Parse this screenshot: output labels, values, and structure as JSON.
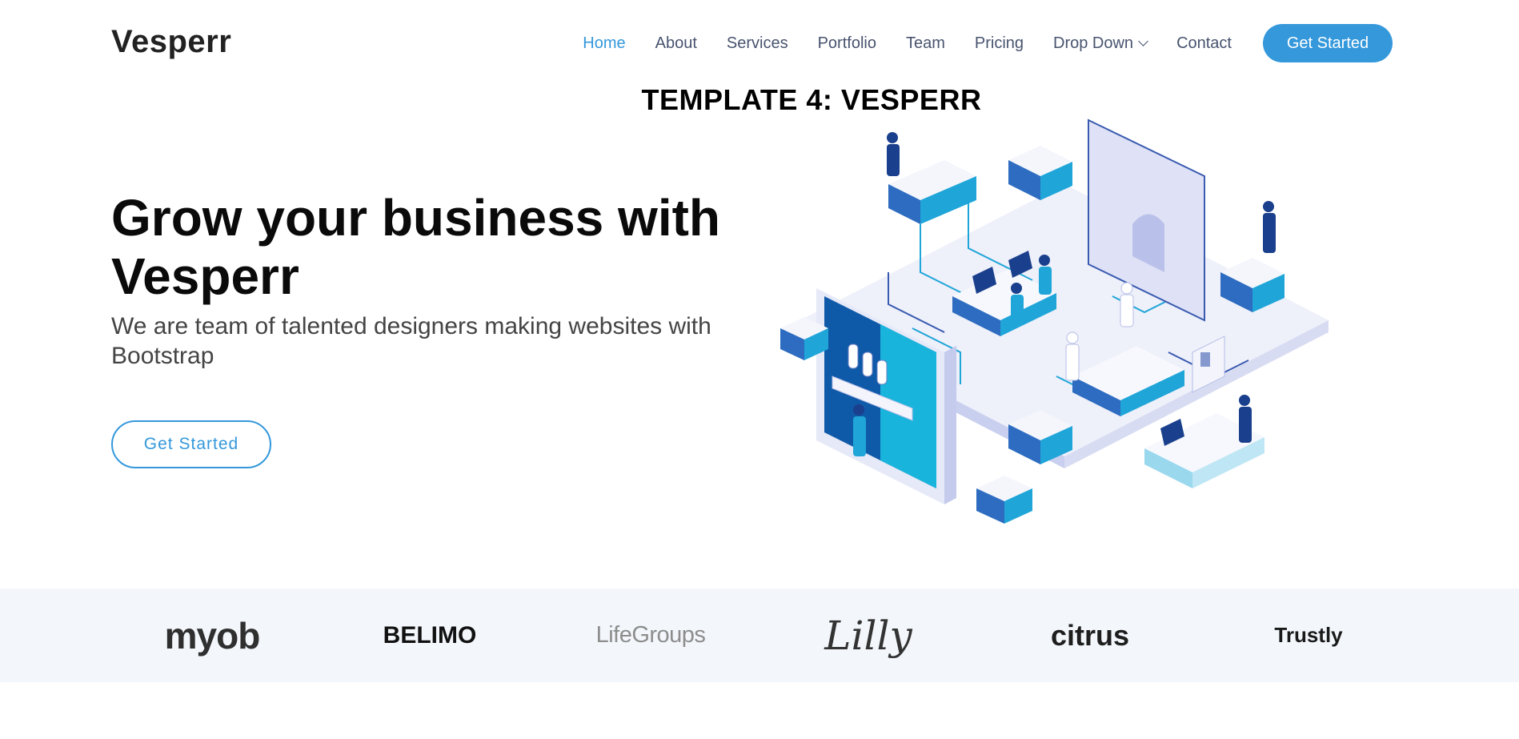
{
  "header": {
    "logo": "Vesperr",
    "nav": [
      {
        "label": "Home",
        "active": true
      },
      {
        "label": "About",
        "active": false
      },
      {
        "label": "Services",
        "active": false
      },
      {
        "label": "Portfolio",
        "active": false
      },
      {
        "label": "Team",
        "active": false
      },
      {
        "label": "Pricing",
        "active": false
      },
      {
        "label": "Drop Down",
        "active": false,
        "dropdown": true
      },
      {
        "label": "Contact",
        "active": false
      }
    ],
    "cta": "Get Started"
  },
  "template_title": "TEMPLATE 4: VESPERR",
  "hero": {
    "title_line1": "Grow your business with",
    "title_line2": "Vesperr",
    "subtitle": "We are team of talented designers making websites with Bootstrap",
    "cta": "Get Started",
    "illustration": "isometric-office-illustration"
  },
  "clients": [
    "myob",
    "BELIMO",
    "LifeGroups",
    "Lilly",
    "citrus",
    "Trustly"
  ],
  "colors": {
    "accent": "#3498db",
    "clients_bg": "#f3f7fb",
    "nav_text": "#47536e"
  }
}
